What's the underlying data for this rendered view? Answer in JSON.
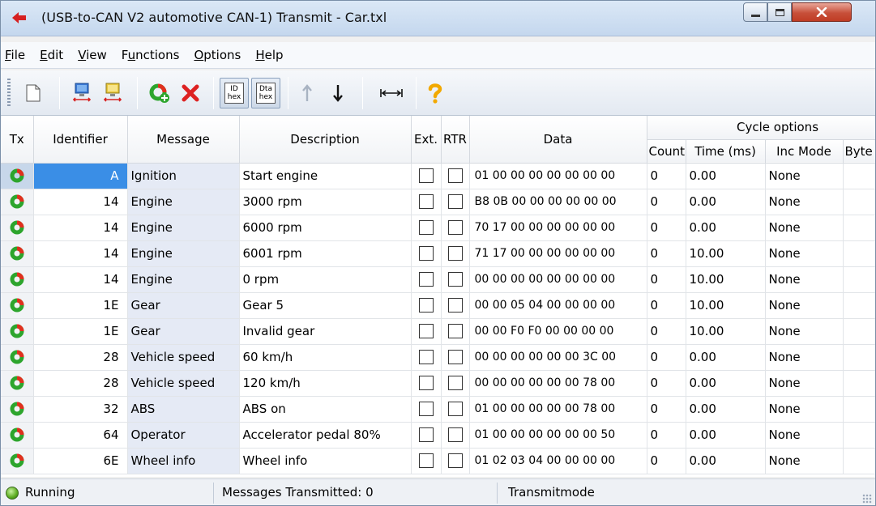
{
  "window": {
    "title": "(USB-to-CAN V2 automotive  CAN-1) Transmit - Car.txl"
  },
  "menu": [
    {
      "label_ul": "F",
      "label_rest": "ile"
    },
    {
      "label_ul": "E",
      "label_rest": "dit"
    },
    {
      "label_ul": "V",
      "label_rest": "iew"
    },
    {
      "label_pre": "F",
      "label_ul": "u",
      "label_rest": "nctions"
    },
    {
      "label_ul": "O",
      "label_rest": "ptions"
    },
    {
      "label_ul": "H",
      "label_rest": "elp"
    }
  ],
  "toolbar": {
    "id_hex_top": "ID",
    "id_hex_bottom": "hex",
    "data_hex_top": "Dta",
    "data_hex_bottom": "hex"
  },
  "columns": {
    "tx": "Tx",
    "identifier": "Identifier",
    "message": "Message",
    "description": "Description",
    "ext": "Ext.",
    "rtr": "RTR",
    "data": "Data",
    "cycle_options": "Cycle options",
    "count": "Count",
    "time": "Time (ms)",
    "inc_mode": "Inc Mode",
    "byte": "Byte"
  },
  "rows": [
    {
      "id": "A",
      "message": "Ignition",
      "description": "Start engine",
      "data": "01 00 00 00 00 00 00 00",
      "count": "0",
      "time": "0.00",
      "inc_mode": "None"
    },
    {
      "id": "14",
      "message": "Engine",
      "description": "3000 rpm",
      "data": "B8 0B 00 00 00 00 00 00",
      "count": "0",
      "time": "0.00",
      "inc_mode": "None"
    },
    {
      "id": "14",
      "message": "Engine",
      "description": "6000 rpm",
      "data": "70 17 00 00 00 00 00 00",
      "count": "0",
      "time": "0.00",
      "inc_mode": "None"
    },
    {
      "id": "14",
      "message": "Engine",
      "description": "6001 rpm",
      "data": "71 17 00 00 00 00 00 00",
      "count": "0",
      "time": "10.00",
      "inc_mode": "None"
    },
    {
      "id": "14",
      "message": "Engine",
      "description": "0 rpm",
      "data": "00 00 00 00 00 00 00 00",
      "count": "0",
      "time": "10.00",
      "inc_mode": "None"
    },
    {
      "id": "1E",
      "message": "Gear",
      "description": "Gear 5",
      "data": "00 00 05 04 00 00 00 00",
      "count": "0",
      "time": "10.00",
      "inc_mode": "None"
    },
    {
      "id": "1E",
      "message": "Gear",
      "description": "Invalid gear",
      "data": "00 00 F0 F0 00 00 00 00",
      "count": "0",
      "time": "10.00",
      "inc_mode": "None"
    },
    {
      "id": "28",
      "message": "Vehicle speed",
      "description": "60 km/h",
      "data": "00 00 00 00 00 00 3C 00",
      "count": "0",
      "time": "0.00",
      "inc_mode": "None"
    },
    {
      "id": "28",
      "message": "Vehicle speed",
      "description": "120 km/h",
      "data": "00 00 00 00 00 00 78 00",
      "count": "0",
      "time": "0.00",
      "inc_mode": "None"
    },
    {
      "id": "32",
      "message": "ABS",
      "description": "ABS on",
      "data": "01 00 00 00 00 00 78 00",
      "count": "0",
      "time": "0.00",
      "inc_mode": "None"
    },
    {
      "id": "64",
      "message": "Operator",
      "description": "Accelerator pedal 80%",
      "data": "01 00 00 00 00 00 00 50",
      "count": "0",
      "time": "0.00",
      "inc_mode": "None"
    },
    {
      "id": "6E",
      "message": "Wheel info",
      "description": "Wheel info",
      "data": "01 02 03 04 00 00 00 00",
      "count": "0",
      "time": "0.00",
      "inc_mode": "None"
    }
  ],
  "status": {
    "state": "Running",
    "messages_transmitted": "Messages Transmitted: 0",
    "mode": "Transmitmode"
  },
  "colors": {
    "selected_identifier_bg": "#3a8ee6",
    "message_column_bg": "#e5eaf5",
    "close_button": "#c7503a"
  }
}
